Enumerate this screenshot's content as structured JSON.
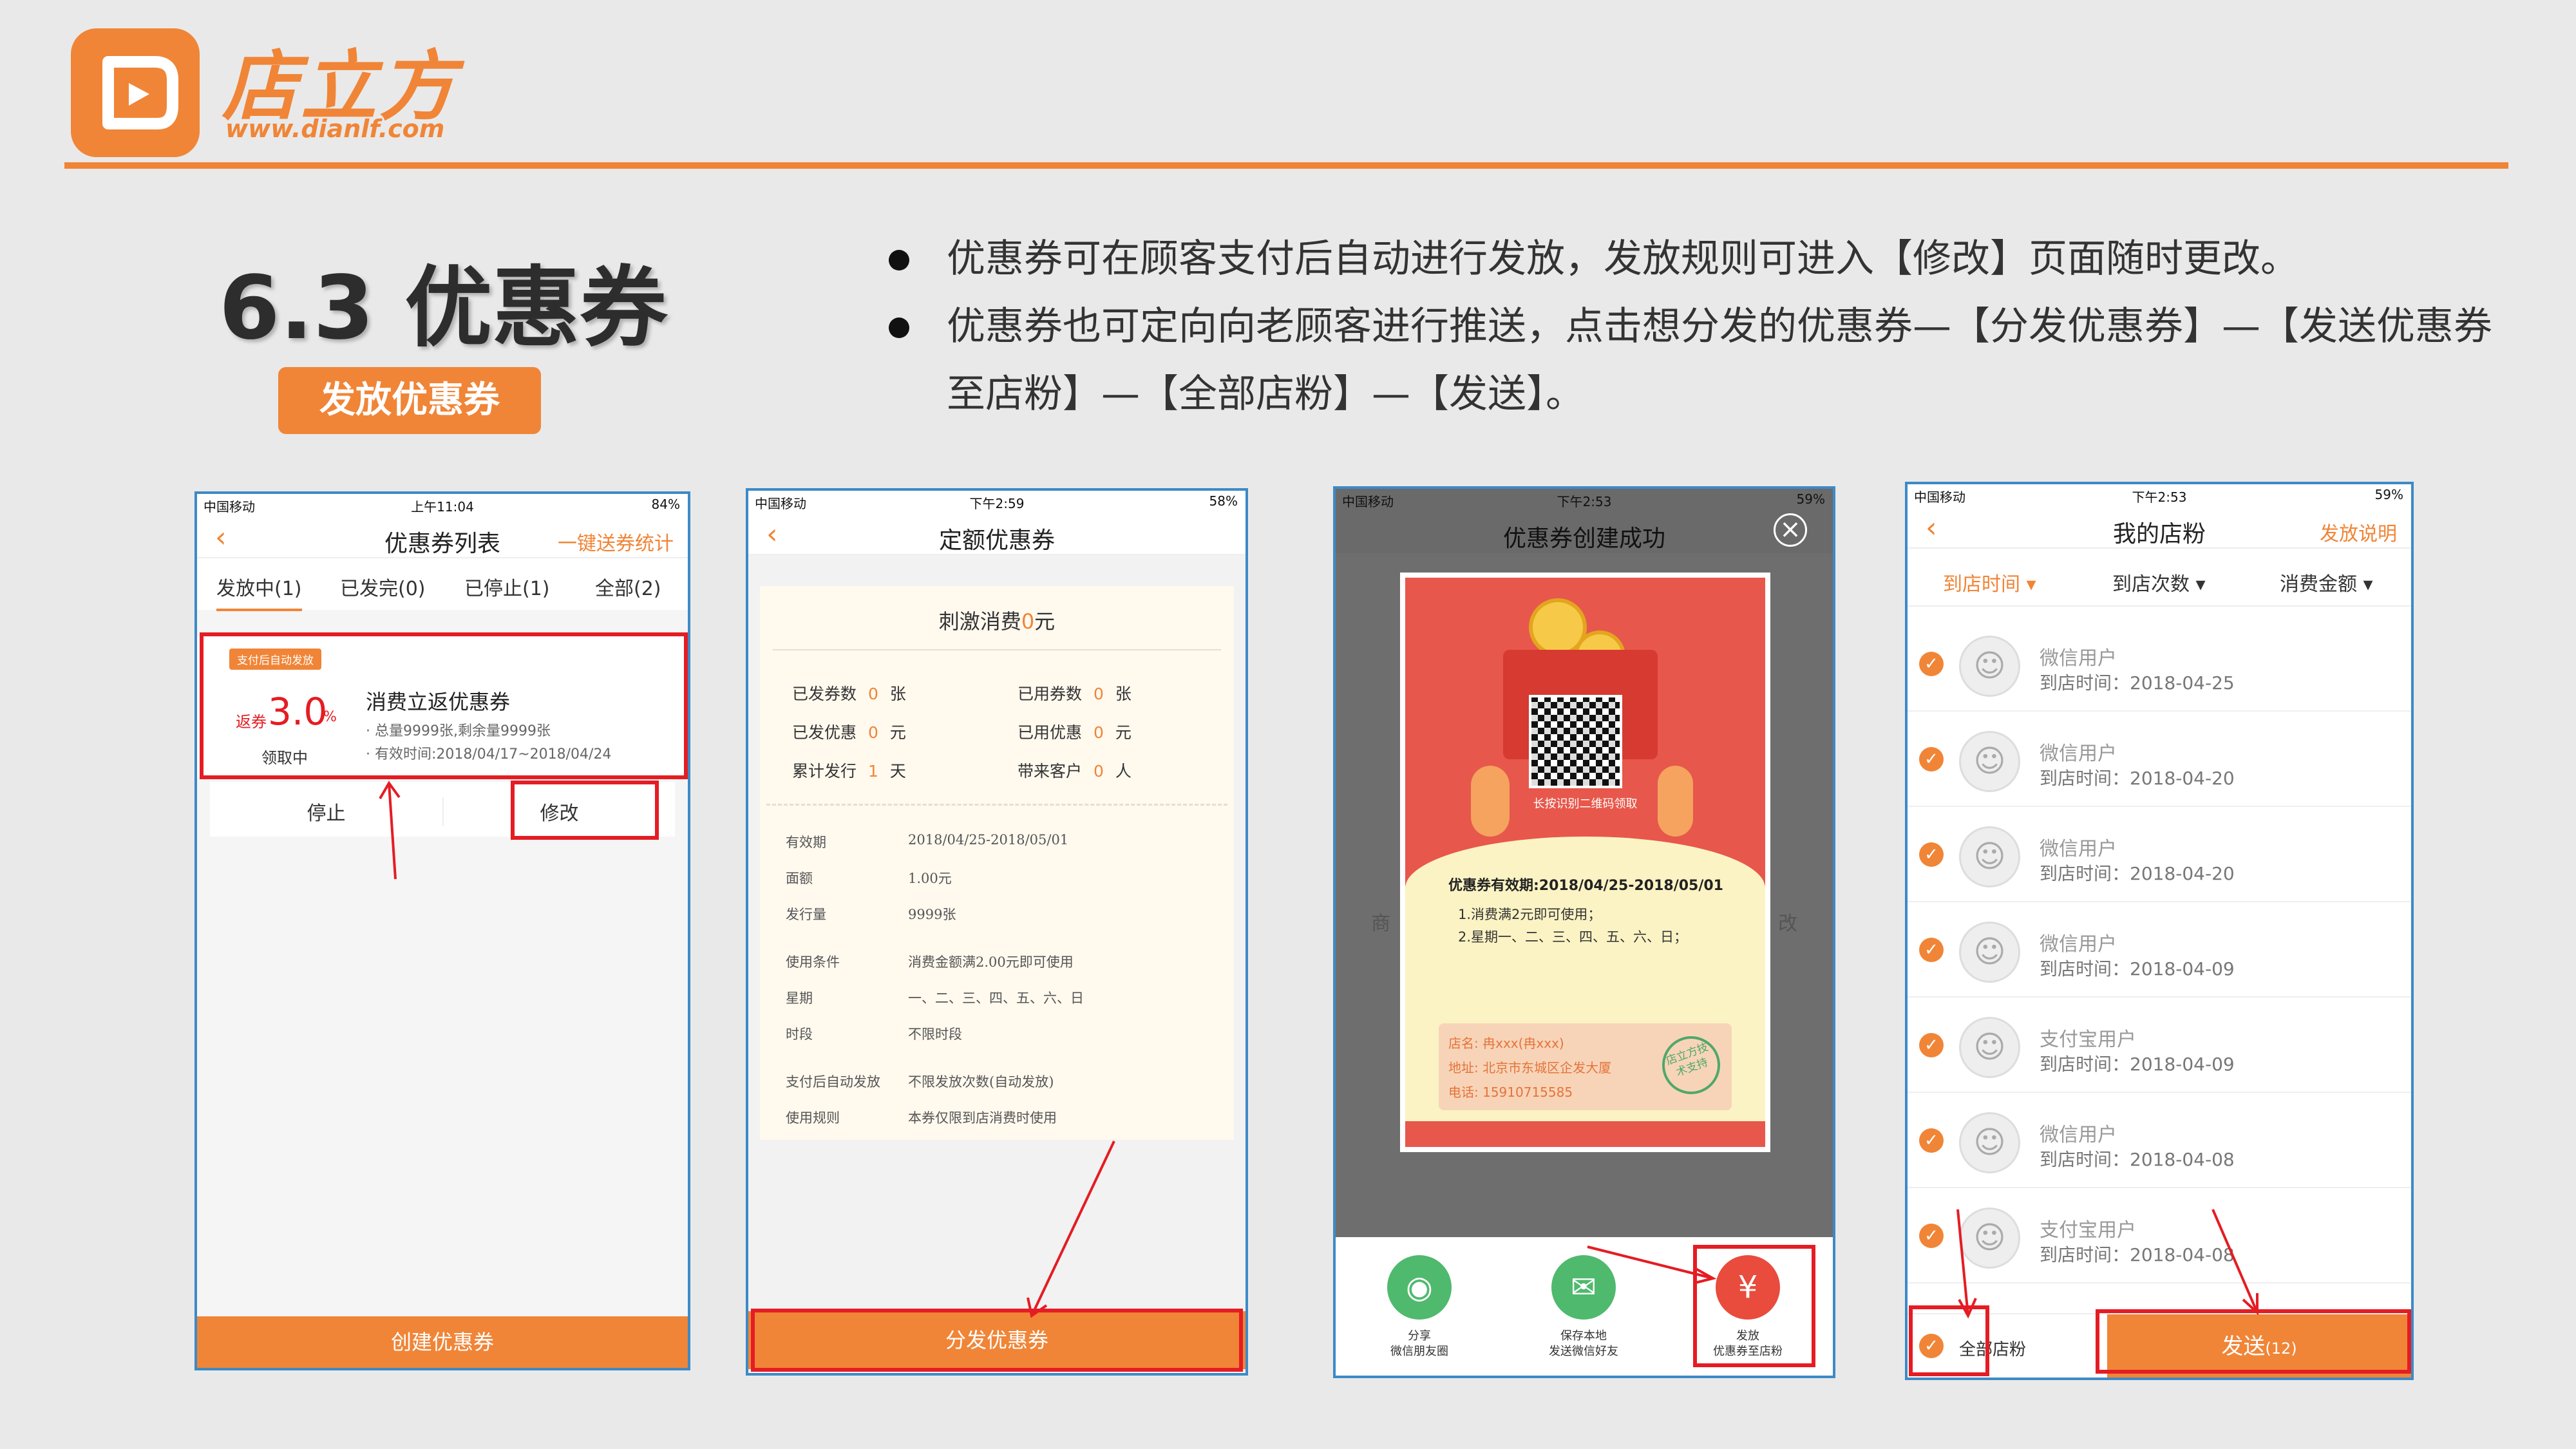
{
  "brand": {
    "name": "店立方",
    "url": "www.dianlf.com",
    "accent": "#f08537"
  },
  "section": {
    "title": "6.3 优惠券",
    "subtitle": "发放优惠券"
  },
  "bullets": [
    "优惠券可在顾客支付后自动进行发放，发放规则可进入【修改】页面随时更改。",
    "优惠券也可定向向老顾客进行推送，点击想分发的优惠券—【分发优惠券】—【发送优惠券至店粉】—【全部店粉】—【发送】。"
  ],
  "phone1": {
    "status": {
      "carrier": "中国移动",
      "time": "上午11:04",
      "battery": "84%"
    },
    "title": "优惠券列表",
    "right": "一键送券统计",
    "tabs": [
      "发放中(1)",
      "已发完(0)",
      "已停止(1)",
      "全部(2)"
    ],
    "coupon": {
      "tag": "支付后自动发放",
      "prefix": "返券",
      "value": "3.0",
      "unit": "%",
      "state": "领取中",
      "name": "消费立返优惠券",
      "line1": "· 总量9999张,剩余量9999张",
      "line2": "· 有效时间:2018/04/17~2018/04/24"
    },
    "stop": "停止",
    "edit": "修改",
    "button": "创建优惠券"
  },
  "phone2": {
    "status": {
      "carrier": "中国移动",
      "time": "下午2:59",
      "battery": "58%"
    },
    "title": "定额优惠券",
    "header": {
      "before": "刺激消费",
      "amount": "0",
      "after": "元"
    },
    "stats": [
      {
        "label": "已发券数",
        "value": "0",
        "unit": "张"
      },
      {
        "label": "已用券数",
        "value": "0",
        "unit": "张"
      },
      {
        "label": "已发优惠",
        "value": "0",
        "unit": "元"
      },
      {
        "label": "已用优惠",
        "value": "0",
        "unit": "元"
      },
      {
        "label": "累计发行",
        "value": "1",
        "unit": "天"
      },
      {
        "label": "带来客户",
        "value": "0",
        "unit": "人"
      }
    ],
    "details": [
      {
        "k": "有效期",
        "v": "2018/04/25-2018/05/01"
      },
      {
        "k": "面额",
        "v": "1.00元"
      },
      {
        "k": "发行量",
        "v": "9999张"
      },
      {
        "k": "使用条件",
        "v": "消费金额满2.00元即可使用"
      },
      {
        "k": "星期",
        "v": "一、二、三、四、五、六、日"
      },
      {
        "k": "时段",
        "v": "不限时段"
      },
      {
        "k": "支付后自动发放",
        "v": "不限发放次数(自动发放)"
      },
      {
        "k": "使用规则",
        "v": "本券仅限到店消费时使用"
      }
    ],
    "button": "分发优惠券"
  },
  "phone3": {
    "status": {
      "carrier": "中国移动",
      "time": "下午2:53",
      "battery": "59%"
    },
    "title": "优惠券创建成功",
    "close": "×",
    "qr_caption": "长按识别二维码领取",
    "valid": "优惠券有效期:2018/04/25-2018/05/01",
    "rules": [
      "1.消费满2元即可使用；",
      "2.星期一、二、三、四、五、六、日；"
    ],
    "shop": {
      "name_label": "店名:",
      "name": "冉xxx(冉xxx)",
      "addr_label": "地址:",
      "addr": "北京市东城区企发大厦",
      "tel_label": "电话:",
      "tel": "15910715585"
    },
    "stamp": "店立方技术支持",
    "actions": [
      {
        "icon": "camera-icon",
        "l1": "分享",
        "l2": "微信朋友圈",
        "color": "#4fb96e"
      },
      {
        "icon": "wechat-icon",
        "l1": "保存本地",
        "l2": "发送微信好友",
        "color": "#4fb96e"
      },
      {
        "icon": "ticket-icon",
        "l1": "发放",
        "l2": "优惠券至店粉",
        "color": "#e94b3c"
      }
    ],
    "bg_left": "商",
    "bg_right": "改"
  },
  "phone4": {
    "status": {
      "carrier": "中国移动",
      "time": "下午2:53",
      "battery": "59%"
    },
    "title": "我的店粉",
    "right": "发放说明",
    "filters": [
      "到店时间",
      "到店次数",
      "消费金额"
    ],
    "fans": [
      {
        "name": "微信用户",
        "time": "到店时间：2018-04-25"
      },
      {
        "name": "微信用户",
        "time": "到店时间：2018-04-20"
      },
      {
        "name": "微信用户",
        "time": "到店时间：2018-04-20"
      },
      {
        "name": "微信用户",
        "time": "到店时间：2018-04-09"
      },
      {
        "name": "支付宝用户",
        "time": "到店时间：2018-04-09"
      },
      {
        "name": "微信用户",
        "time": "到店时间：2018-04-08"
      },
      {
        "name": "支付宝用户",
        "time": "到店时间：2018-04-08"
      }
    ],
    "all": "全部店粉",
    "send": "发送",
    "count": "(12)"
  }
}
